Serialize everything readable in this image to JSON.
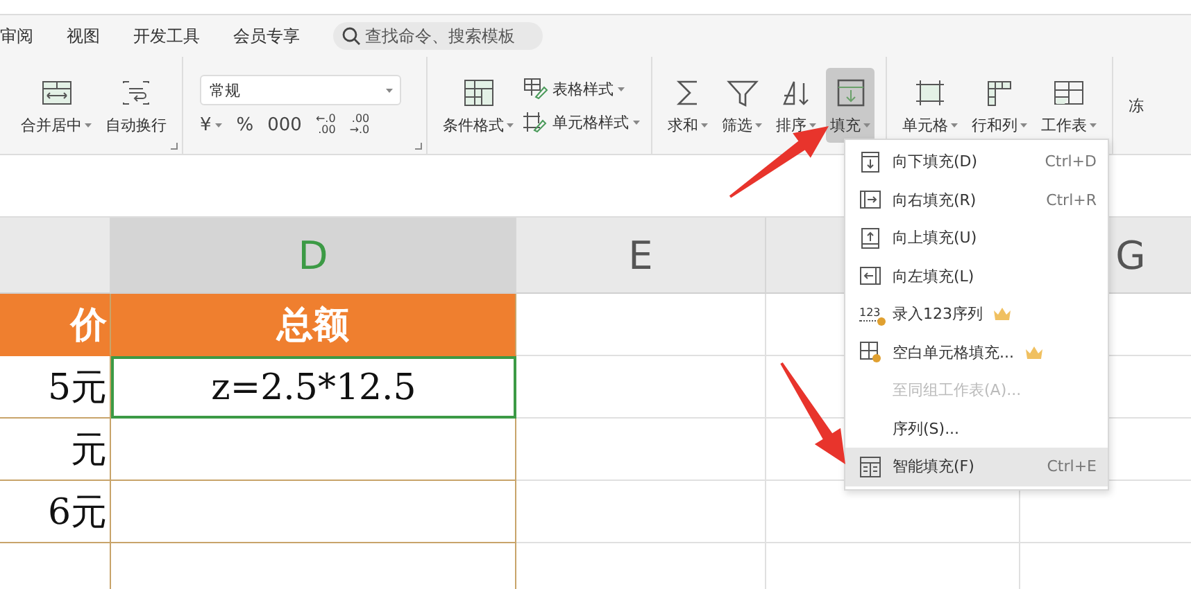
{
  "menu_tabs": [
    {
      "label": "审阅"
    },
    {
      "label": "视图"
    },
    {
      "label": "开发工具"
    },
    {
      "label": "会员专享"
    }
  ],
  "search": {
    "placeholder": "查找命令、搜索模板"
  },
  "ribbon": {
    "groups": [
      {
        "launcher": true,
        "buttons": [
          {
            "kind": "merge",
            "label": "合并居中",
            "dropdown": true,
            "selected": false
          },
          {
            "kind": "wrap",
            "label": "自动换行",
            "selected": false
          }
        ]
      },
      {
        "kind": "number",
        "launcher": true,
        "format": "常规",
        "symbols": [
          {
            "text": "¥",
            "dropdown": true
          },
          {
            "text": "%"
          },
          {
            "text": "000"
          }
        ],
        "decimals": [
          {
            "top": "←.0",
            "bottom": ".00"
          },
          {
            "top": ".00",
            "bottom": "→.0"
          }
        ]
      },
      {
        "buttons": [
          {
            "kind": "conditional",
            "label": "条件格式",
            "dropdown": true,
            "selected": false
          }
        ],
        "small": [
          {
            "kind": "table-style",
            "label": "表格样式",
            "dropdown": true
          },
          {
            "kind": "cell-style",
            "label": "单元格样式",
            "dropdown": true
          }
        ]
      },
      {
        "buttons": [
          {
            "kind": "sum",
            "label": "求和",
            "dropdown": true,
            "selected": false
          },
          {
            "kind": "filter",
            "label": "筛选",
            "dropdown": true,
            "selected": false
          },
          {
            "kind": "sort",
            "label": "排序",
            "dropdown": true,
            "selected": false
          },
          {
            "kind": "fill",
            "label": "填充",
            "dropdown": true,
            "selected": true
          }
        ]
      },
      {
        "buttons": [
          {
            "kind": "cell",
            "label": "单元格",
            "dropdown": true,
            "selected": false
          },
          {
            "kind": "rows-cols",
            "label": "行和列",
            "dropdown": true,
            "selected": false
          },
          {
            "kind": "sheet",
            "label": "工作表",
            "dropdown": true,
            "selected": false
          }
        ]
      },
      {
        "buttons": [
          {
            "kind": "cut",
            "label": "冻",
            "selected": false
          }
        ]
      }
    ]
  },
  "sheet": {
    "columns": [
      {
        "selected": false
      },
      {
        "label": "D",
        "selected": true
      },
      {
        "label": "E",
        "selected": false
      },
      {
        "selected": false
      },
      {
        "label": "G",
        "selected": false
      }
    ],
    "rows": [
      {
        "kind": "header",
        "cells": [
          {
            "text": "价",
            "selected": false
          },
          {
            "text": "总额",
            "selected": false
          }
        ]
      },
      {
        "kind": "data",
        "cells": [
          {
            "text": "5元",
            "selected": false
          },
          {
            "text": "z=2.5*12.5",
            "selected": true
          }
        ]
      },
      {
        "kind": "data",
        "cells": [
          {
            "text": "元",
            "selected": false
          }
        ]
      },
      {
        "kind": "data",
        "cells": [
          {
            "text": "6元",
            "selected": false
          }
        ]
      }
    ]
  },
  "fill_menu": {
    "items": [
      {
        "kind": "down",
        "label": "向下填充(D)",
        "shortcut": "Ctrl+D",
        "premium": false,
        "disabled": false,
        "selected": false
      },
      {
        "kind": "right",
        "label": "向右填充(R)",
        "shortcut": "Ctrl+R",
        "premium": false,
        "disabled": false,
        "selected": false
      },
      {
        "kind": "up",
        "label": "向上填充(U)",
        "premium": false,
        "disabled": false,
        "selected": false
      },
      {
        "kind": "left",
        "label": "向左填充(L)",
        "premium": false,
        "disabled": false,
        "selected": false
      },
      {
        "kind": "sequence-entry",
        "icon_text": "123",
        "label": "录入123序列",
        "premium": true,
        "disabled": false,
        "selected": false
      },
      {
        "kind": "blank-cells",
        "label": "空白单元格填充...",
        "premium": true,
        "disabled": false,
        "selected": false
      },
      {
        "kind": "plain",
        "label": "至同组工作表(A)...",
        "premium": false,
        "disabled": true,
        "selected": false
      },
      {
        "kind": "plain",
        "label": "序列(S)...",
        "premium": false,
        "disabled": false,
        "selected": false
      },
      {
        "kind": "smart",
        "label": "智能填充(F)",
        "shortcut": "Ctrl+E",
        "premium": false,
        "disabled": false,
        "selected": true
      }
    ]
  }
}
